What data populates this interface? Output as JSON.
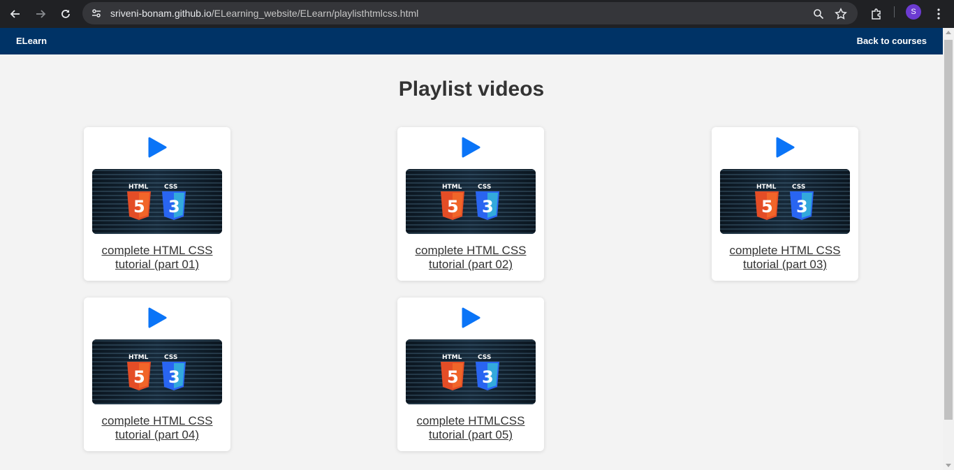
{
  "browser": {
    "url_host": "sriveni-bonam.github.io",
    "url_path": "/ELearning_website/ELearn/playlisthtmlcss.html",
    "profile_initial": "S"
  },
  "navbar": {
    "brand": "ELearn",
    "back_link": "Back to courses"
  },
  "page": {
    "title": "Playlist videos"
  },
  "videos": [
    {
      "title": "complete HTML CSS tutorial (part 01)"
    },
    {
      "title": "complete HTML CSS tutorial (part 02)"
    },
    {
      "title": "complete HTML CSS tutorial (part 03)"
    },
    {
      "title": "complete HTML CSS tutorial (part 04)"
    },
    {
      "title": "complete HTMLCSS tutorial (part 05)"
    }
  ],
  "colors": {
    "navbar": "#003366",
    "play_icon": "#0a74f7",
    "html5": "#e44d26",
    "css3": "#2965f1"
  }
}
